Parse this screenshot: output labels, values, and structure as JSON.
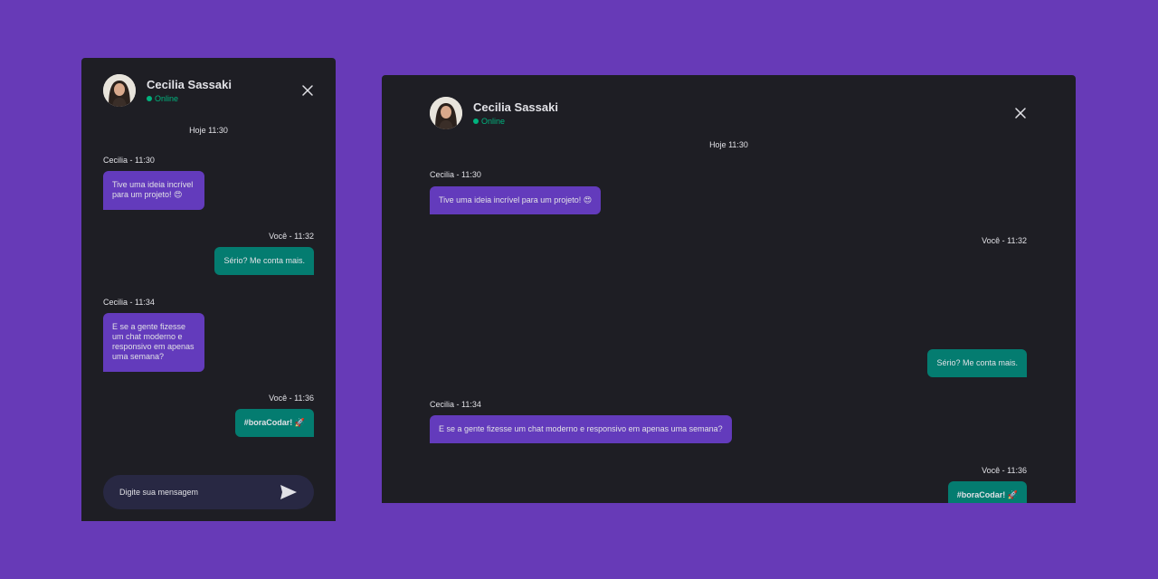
{
  "contact": {
    "name": "Cecilia Sassaki",
    "status": "Online"
  },
  "date_divider": "Hoje 11:30",
  "messages": [
    {
      "meta": "Cecilia - 11:30",
      "text": "Tive uma ideia incrível para um projeto! 😍"
    },
    {
      "meta": "Você - 11:32",
      "text": "Sério? Me conta mais."
    },
    {
      "meta": "Cecilia - 11:34",
      "text": "E se a gente fizesse um chat moderno e responsivo em apenas uma semana?"
    },
    {
      "meta": "Você - 11:36",
      "text": "#boraCodar! 🚀"
    }
  ],
  "composer": {
    "placeholder": "Digite sua mensagem"
  },
  "icons": {
    "close": "close-icon",
    "send": "send-icon",
    "status": "online-dot-icon"
  },
  "colors": {
    "background": "#673ab7",
    "panel": "#1e1e24",
    "incoming_bubble": "#633bbc",
    "outgoing_bubble": "#047c70",
    "online": "#00b37e",
    "composer": "#282843"
  }
}
